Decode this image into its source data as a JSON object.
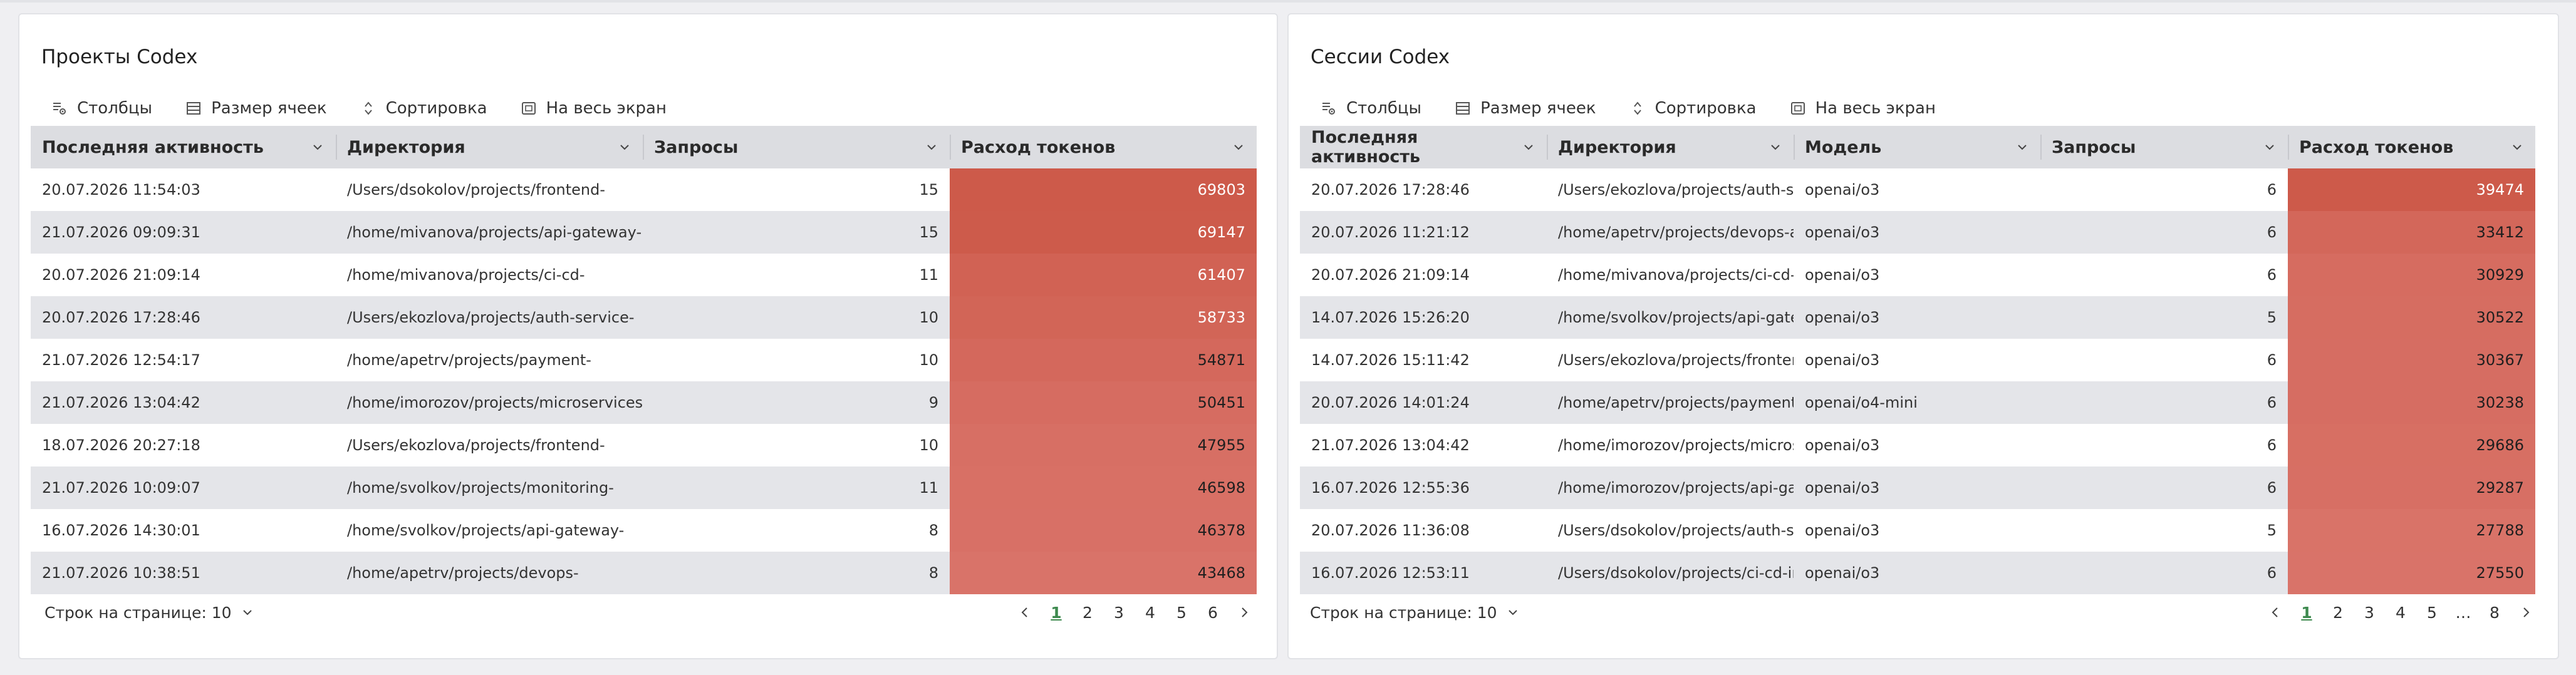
{
  "colors": {
    "token_high": "#cd5a4a",
    "token_low": "#d97369",
    "active_page": "#3e8a4f"
  },
  "toolbar": {
    "columns": "Столбцы",
    "cell_size": "Размер ячеек",
    "sort": "Сортировка",
    "fullscreen": "На весь экран"
  },
  "projects": {
    "title": "Проекты Codex",
    "headers": [
      "Последняя активность",
      "Директория",
      "Запросы",
      "Расход токенов"
    ],
    "rows": [
      {
        "time": "20.07.2026 11:54:03",
        "dir": "/Users/dsokolov/projects/frontend-",
        "requests": "15",
        "tokens": "69803"
      },
      {
        "time": "21.07.2026 09:09:31",
        "dir": "/home/mivanova/projects/api-gateway-",
        "requests": "15",
        "tokens": "69147"
      },
      {
        "time": "20.07.2026 21:09:14",
        "dir": "/home/mivanova/projects/ci-cd-",
        "requests": "11",
        "tokens": "61407"
      },
      {
        "time": "20.07.2026 17:28:46",
        "dir": "/Users/ekozlova/projects/auth-service-",
        "requests": "10",
        "tokens": "58733"
      },
      {
        "time": "21.07.2026 12:54:17",
        "dir": "/home/apetrv/projects/payment-",
        "requests": "10",
        "tokens": "54871"
      },
      {
        "time": "21.07.2026 13:04:42",
        "dir": "/home/imorozov/projects/microservices-",
        "requests": "9",
        "tokens": "50451"
      },
      {
        "time": "18.07.2026 20:27:18",
        "dir": "/Users/ekozlova/projects/frontend-",
        "requests": "10",
        "tokens": "47955"
      },
      {
        "time": "21.07.2026 10:09:07",
        "dir": "/home/svolkov/projects/monitoring-",
        "requests": "11",
        "tokens": "46598"
      },
      {
        "time": "16.07.2026 14:30:01",
        "dir": "/home/svolkov/projects/api-gateway-",
        "requests": "8",
        "tokens": "46378"
      },
      {
        "time": "21.07.2026 10:38:51",
        "dir": "/home/apetrv/projects/devops-",
        "requests": "8",
        "tokens": "43468"
      }
    ],
    "rows_per_page_label": "Строк на странице: 10",
    "pages": [
      "1",
      "2",
      "3",
      "4",
      "5",
      "6"
    ]
  },
  "sessions": {
    "title": "Сессии Codex",
    "headers": [
      "Последняя активность",
      "Директория",
      "Модель",
      "Запросы",
      "Расход токенов"
    ],
    "rows": [
      {
        "time": "20.07.2026 17:28:46",
        "dir": "/Users/ekozlova/projects/auth-ser",
        "model": "openai/o3",
        "requests": "6",
        "tokens": "39474"
      },
      {
        "time": "20.07.2026 11:21:12",
        "dir": "/home/apetrv/projects/devops-au",
        "model": "openai/o3",
        "requests": "6",
        "tokens": "33412"
      },
      {
        "time": "20.07.2026 21:09:14",
        "dir": "/home/mivanova/projects/ci-cd-i",
        "model": "openai/o3",
        "requests": "6",
        "tokens": "30929"
      },
      {
        "time": "14.07.2026 15:26:20",
        "dir": "/home/svolkov/projects/api-gate",
        "model": "openai/o3",
        "requests": "5",
        "tokens": "30522"
      },
      {
        "time": "14.07.2026 15:11:42",
        "dir": "/Users/ekozlova/projects/fronten",
        "model": "openai/o3",
        "requests": "6",
        "tokens": "30367"
      },
      {
        "time": "20.07.2026 14:01:24",
        "dir": "/home/apetrv/projects/payment-i",
        "model": "openai/o4-mini",
        "requests": "6",
        "tokens": "30238"
      },
      {
        "time": "21.07.2026 13:04:42",
        "dir": "/home/imorozov/projects/micros",
        "model": "openai/o3",
        "requests": "6",
        "tokens": "29686"
      },
      {
        "time": "16.07.2026 12:55:36",
        "dir": "/home/imorozov/projects/api-gat",
        "model": "openai/o3",
        "requests": "6",
        "tokens": "29287"
      },
      {
        "time": "20.07.2026 11:36:08",
        "dir": "/Users/dsokolov/projects/auth-se",
        "model": "openai/o3",
        "requests": "5",
        "tokens": "27788"
      },
      {
        "time": "16.07.2026 12:53:11",
        "dir": "/Users/dsokolov/projects/ci-cd-in",
        "model": "openai/o3",
        "requests": "6",
        "tokens": "27550"
      }
    ],
    "rows_per_page_label": "Строк на странице: 10",
    "pages": [
      "1",
      "2",
      "3",
      "4",
      "5",
      "…",
      "8"
    ]
  }
}
